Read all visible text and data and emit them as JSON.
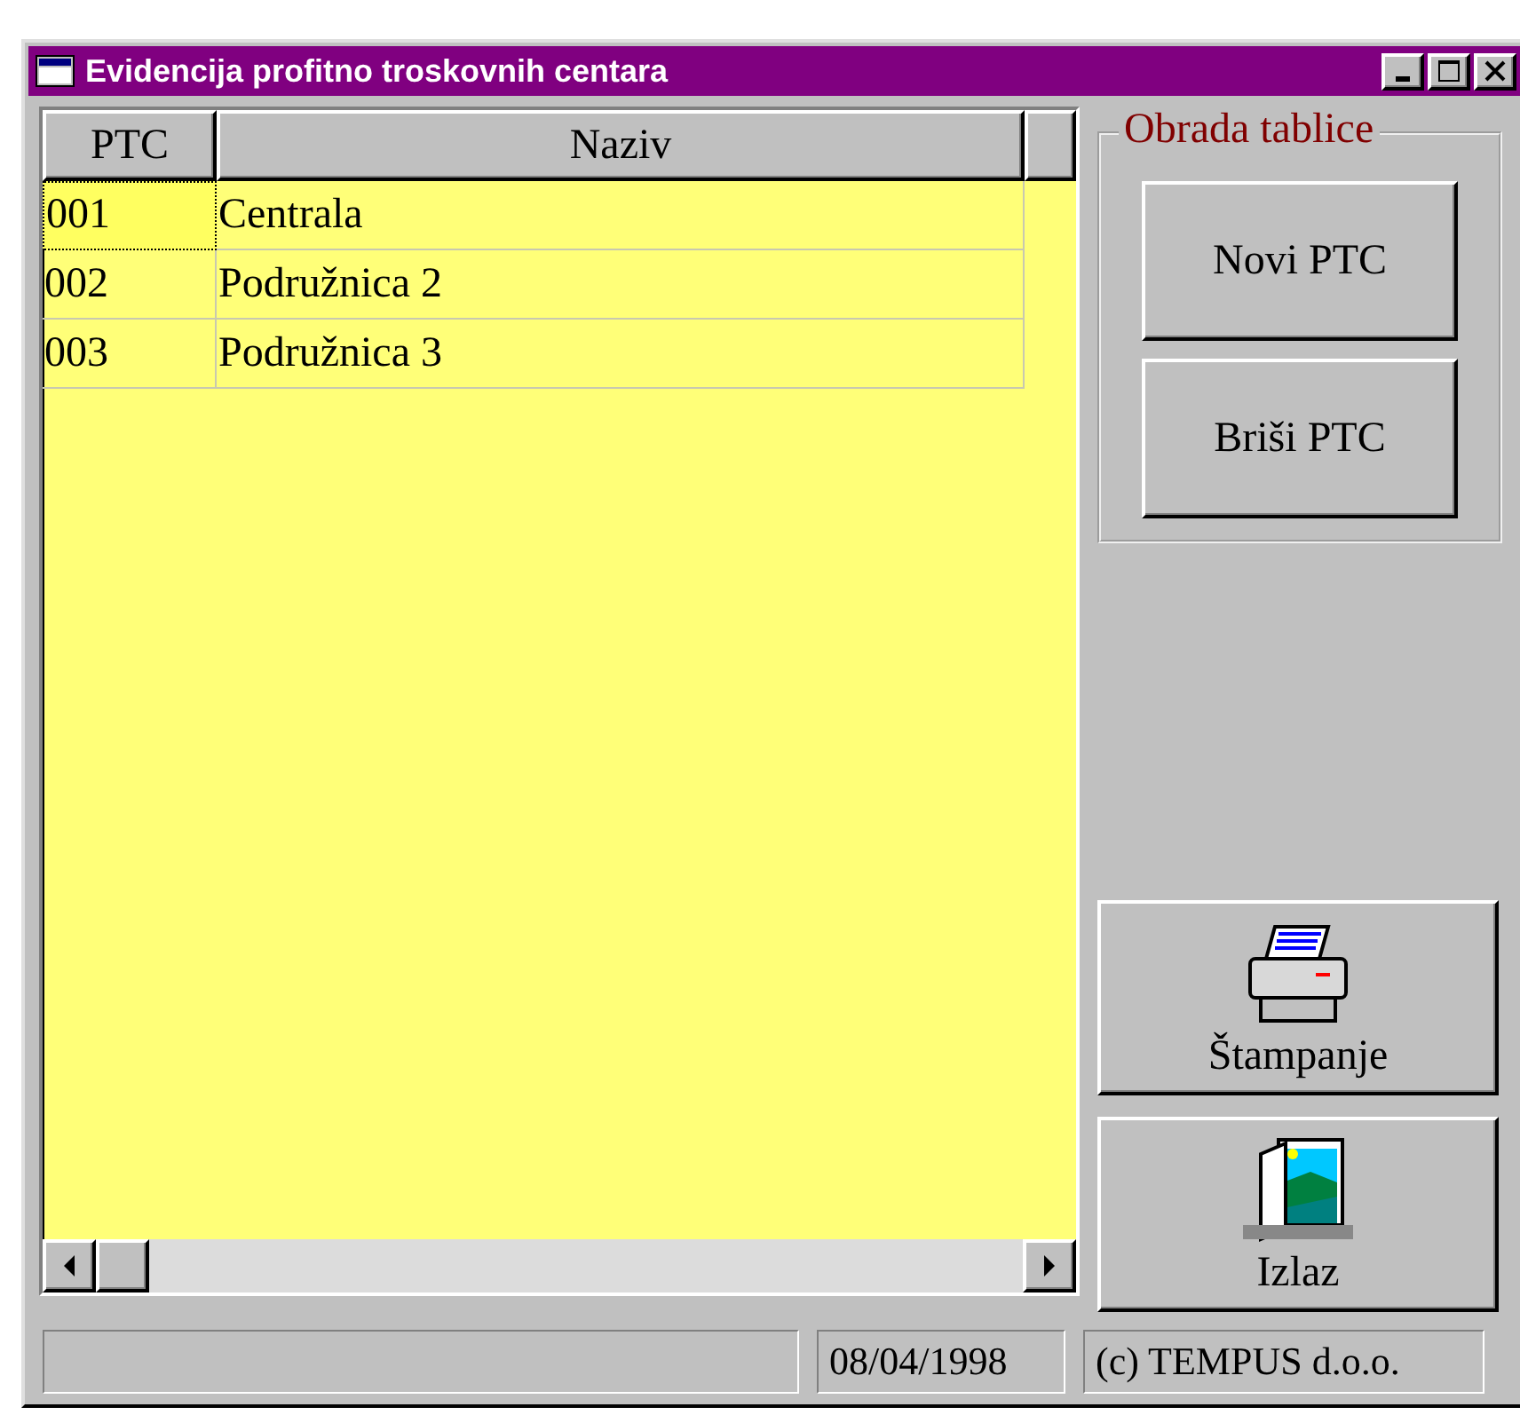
{
  "window": {
    "title": "Evidencija profitno troskovnih centara"
  },
  "table": {
    "columns": [
      {
        "label": "PTC"
      },
      {
        "label": "Naziv"
      }
    ],
    "rows": [
      {
        "ptc": "001",
        "naziv": "Centrala",
        "focused": true
      },
      {
        "ptc": "002",
        "naziv": "Podružnica 2",
        "focused": false
      },
      {
        "ptc": "003",
        "naziv": "Podružnica 3",
        "focused": false
      }
    ]
  },
  "group": {
    "title": "Obrada tablice",
    "buttons": [
      {
        "label": "Novi PTC"
      },
      {
        "label": "Briši PTC"
      }
    ]
  },
  "actions": [
    {
      "kind": "print",
      "label": "Štampanje"
    },
    {
      "kind": "exit",
      "label": "Izlaz"
    }
  ],
  "status_bar": {
    "date": "08/04/1998",
    "copyright": "(c) TEMPUS d.o.o."
  }
}
